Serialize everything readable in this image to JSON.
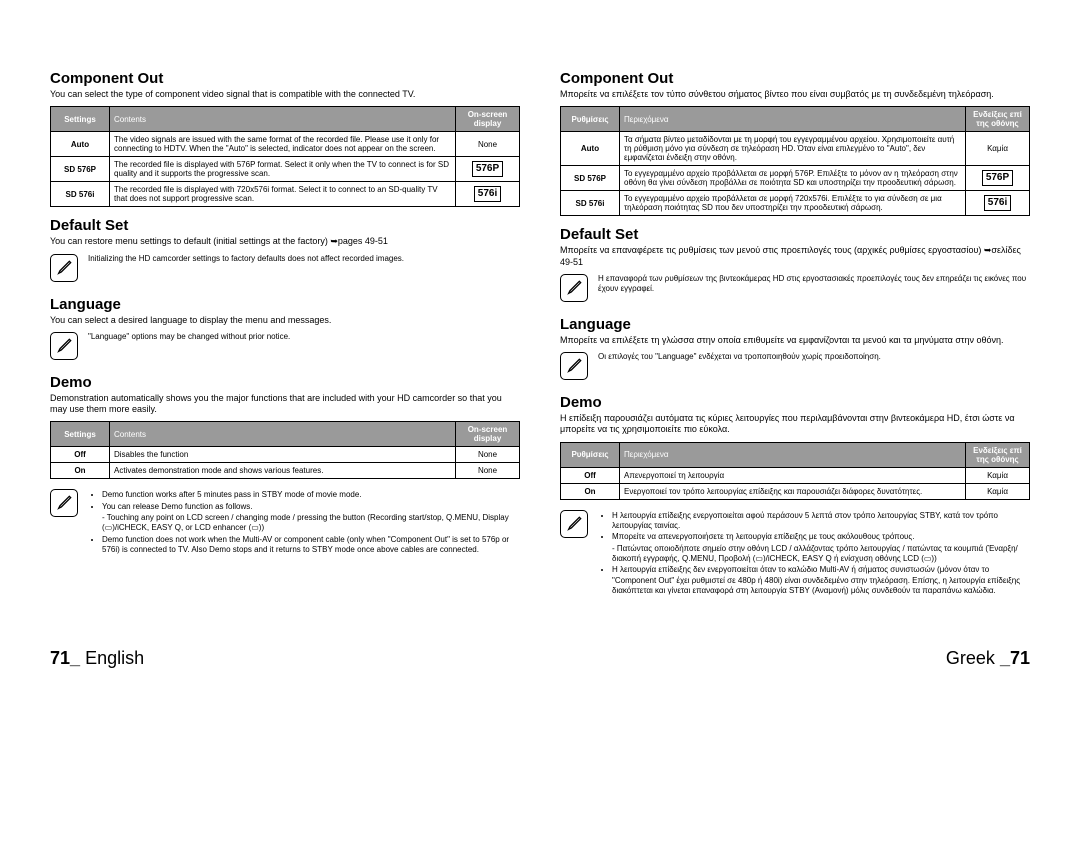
{
  "left": {
    "h1": "Component Out",
    "p1": "You can select the type of component video signal that is compatible with the connected TV.",
    "t1": {
      "h": [
        "Settings",
        "Contents",
        "On-screen display"
      ],
      "r": [
        [
          "Auto",
          "The video signals are issued with the same format of the recorded file. Please use it only for connecting to HDTV. When the \"Auto\" is selected, indicator does not appear on the screen.",
          "None"
        ],
        [
          "SD 576P",
          "The recorded file is displayed with 576P format. Select it only when the TV to connect is for SD quality and it supports the progressive scan.",
          "576P"
        ],
        [
          "SD 576i",
          "The recorded file is displayed with 720x576i format. Select it to connect to an SD-quality TV that does not support progressive scan.",
          "576i"
        ]
      ]
    },
    "h2": "Default Set",
    "p2": "You can restore menu settings to default (initial settings at the factory) ➥pages 49-51",
    "n1": "Initializing the HD camcorder settings to factory defaults does not affect recorded images.",
    "h3": "Language",
    "p3": "You can select a desired language to display the menu and messages.",
    "n2": "\"Language\" options may be changed without prior notice.",
    "h4": "Demo",
    "p4": "Demonstration automatically shows you the major functions that are included with your HD camcorder so that you may use them more easily.",
    "t2": {
      "h": [
        "Settings",
        "Contents",
        "On-screen display"
      ],
      "r": [
        [
          "Off",
          "Disables the function",
          "None"
        ],
        [
          "On",
          "Activates demonstration mode and shows various features.",
          "None"
        ]
      ]
    },
    "n3": [
      "Demo function works after 5 minutes pass in STBY mode of movie mode.",
      "You can release Demo function as follows.",
      "-   Touching any point on LCD screen / changing mode / pressing the button (Recording start/stop, Q.MENU, Display (▭)/iCHECK, EASY Q, or LCD enhancer (▭))",
      "Demo function does not work when the Multi-AV or component cable (only when \"Component Out\" is set to 576p or 576i) is connected to TV. Also Demo stops and it returns to STBY mode once above cables are connected."
    ]
  },
  "right": {
    "h1": "Component Out",
    "p1": "Μπορείτε να επιλέξετε τον τύπο σύνθετου σήματος βίντεο που είναι συμβατός με τη συνδεδεμένη τηλεόραση.",
    "t1": {
      "h": [
        "Ρυθμίσεις",
        "Περιεχόμενα",
        "Ενδείξεις επί της οθόνης"
      ],
      "r": [
        [
          "Auto",
          "Τα σήματα βίντεο μεταδίδονται με τη μορφή του εγγεγραμμένου αρχείου. Χρησιμοποιείτε αυτή τη ρύθμιση μόνο για σύνδεση σε τηλεόραση HD. Όταν είναι επιλεγμένο το \"Auto\", δεν εμφανίζεται ένδειξη στην οθόνη.",
          "Καμία"
        ],
        [
          "SD 576P",
          "Το εγγεγραμμένο αρχείο προβάλλεται σε μορφή 576P. Επιλέξτε το μόνον αν η τηλεόραση στην οθόνη θα γίνει σύνδεση προβάλλει σε ποιότητα SD και υποστηρίζει την προοδευτική σάρωση.",
          "576P"
        ],
        [
          "SD 576i",
          "Το εγγεγραμμένο αρχείο προβάλλεται σε μορφή 720x576i. Επιλέξτε το για σύνδεση σε μια τηλεόραση ποιότητας SD που δεν υποστηρίζει την προοδευτική σάρωση.",
          "576i"
        ]
      ]
    },
    "h2": "Default Set",
    "p2": "Μπορείτε να επαναφέρετε τις ρυθμίσεις των μενού στις προεπιλογές τους (αρχικές ρυθμίσες εργοστασίου) ➥σελίδες 49-51",
    "n1": "Η επαναφορά των ρυθμίσεων της βιντεοκάμερας HD στις εργοστασιακές προεπιλογές τους δεν επηρεάζει τις εικόνες που έχουν εγγραφεί.",
    "h3": "Language",
    "p3": "Μπορείτε να επιλέξετε τη γλώσσα στην οποία επιθυμείτε να εμφανίζονται τα μενού και τα μηνύματα στην οθόνη.",
    "n2": "Οι επιλογές του \"Language\" ενδέχεται να τροποποιηθούν χωρίς προειδοποίηση.",
    "h4": "Demo",
    "p4": "Η επίδειξη παρουσιάζει αυτόματα τις κύριες λειτουργίες που περιλαμβάνονται στην βιντεοκάμερα HD, έτσι ώστε να μπορείτε να τις χρησιμοποιείτε πιο εύκολα.",
    "t2": {
      "h": [
        "Ρυθμίσεις",
        "Περιεχόμενα",
        "Ενδείξεις επί της οθόνης"
      ],
      "r": [
        [
          "Off",
          "Απενεργοποιεί τη λειτουργία",
          "Καμία"
        ],
        [
          "On",
          "Ενεργοποιεί τον τρόπο λειτουργίας επίδειξης και παρουσιάζει διάφορες δυνατότητες.",
          "Καμία"
        ]
      ]
    },
    "n3": [
      "Η λειτουργία επίδειξης ενεργοποιείται αφού περάσουν 5 λεπτά στον τρόπο λειτουργίας STBY, κατά τον τρόπο λειτουργίας ταινίας.",
      "Μπορείτε να απενεργοποιήσετε τη λειτουργία επίδειξης με τους ακόλουθους τρόπους.",
      "-   Πατώντας οποιοδήποτε σημείο στην οθόνη LCD / αλλάζοντας τρόπο λειτουργίας / πατώντας τα κουμπιά (Έναρξη/διακοπή εγγραφής, Q.MENU, Προβολή (▭)/iCHECK, EASY Q ή ενίσχυση οθόνης LCD (▭))",
      "Η λειτουργία επίδειξης δεν ενεργοποιείται όταν το καλώδιο Multi-AV ή σήματος συνιστωσών (μόνον όταν το \"Component Out\" έχει ρυθμιστεί σε 480p ή 480i) είναι συνδεδεμένο στην τηλεόραση. Επίσης, η λειτουργία επίδειξης διακόπτεται και γίνεται επαναφορά στη λειτουργία STBY (Αναμονή) μόλις συνδεθούν τα παραπάνω καλώδια."
    ]
  },
  "footer": {
    "leftNum": "71_",
    "leftLang": "English",
    "rightLang": "Greek",
    "rightNum": "_71"
  }
}
